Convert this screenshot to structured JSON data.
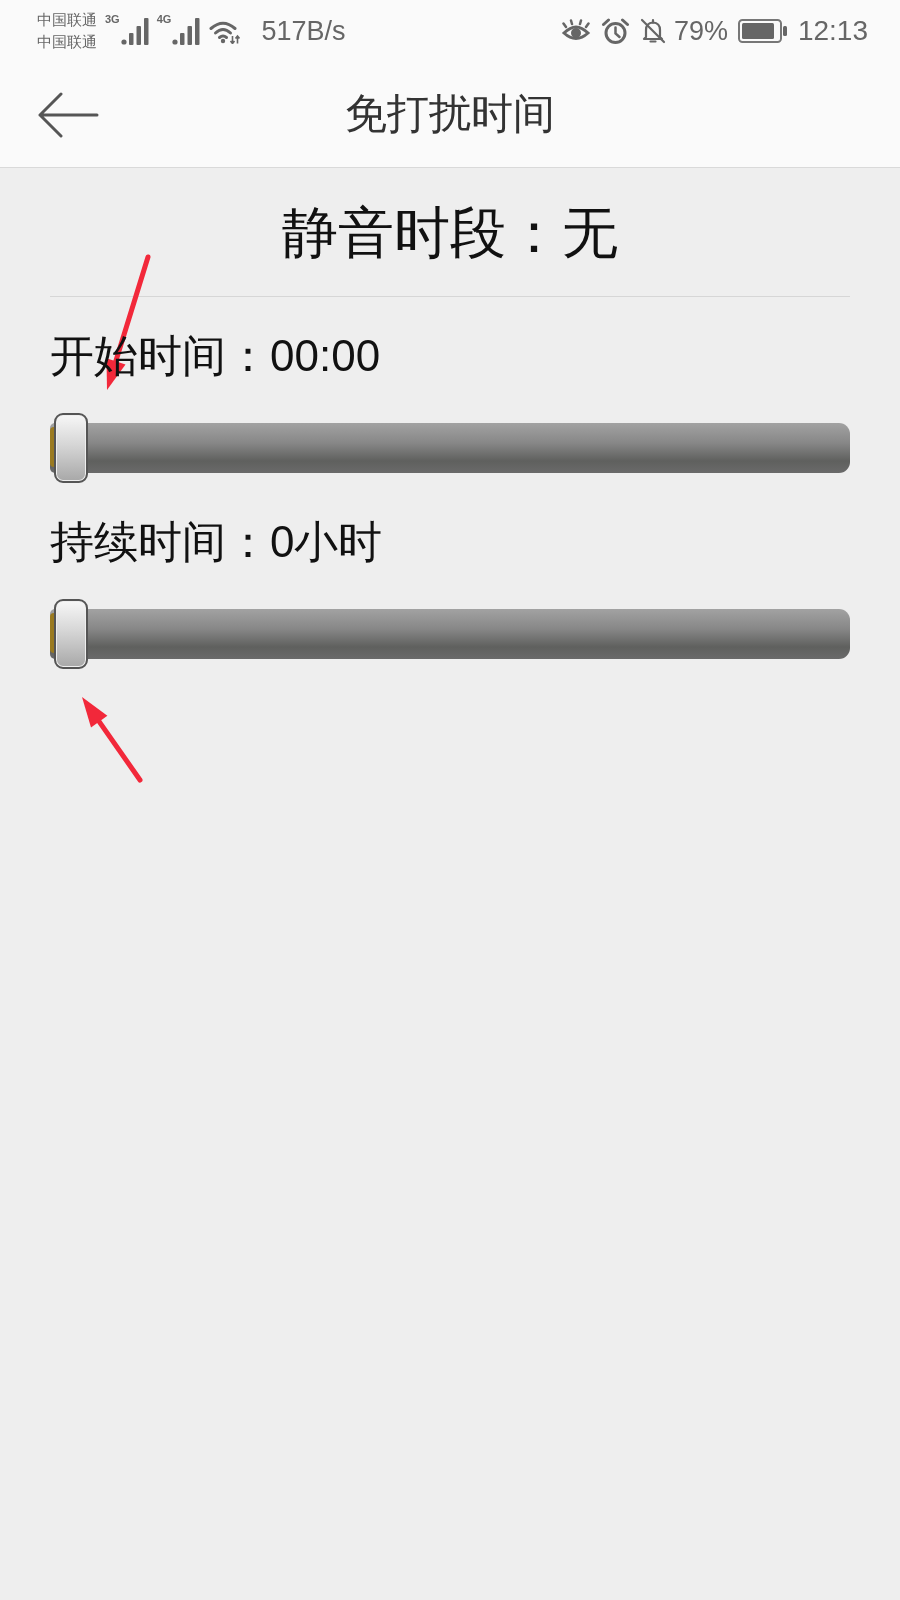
{
  "status_bar": {
    "carriers": [
      "中国联通",
      "中国联通"
    ],
    "signals": [
      {
        "network": "3G"
      },
      {
        "network": "4G"
      }
    ],
    "speed": "517B/s",
    "battery": "79%",
    "time": "12:13"
  },
  "app_bar": {
    "title": "免打扰时间"
  },
  "summary": "静音时段：无",
  "settings": [
    {
      "label": "开始时间：00:00",
      "level": 0,
      "arrow_above": true,
      "arrow_below": false
    },
    {
      "label": "持续时间：0小时",
      "level": 0,
      "arrow_above": false,
      "arrow_below": true
    }
  ]
}
